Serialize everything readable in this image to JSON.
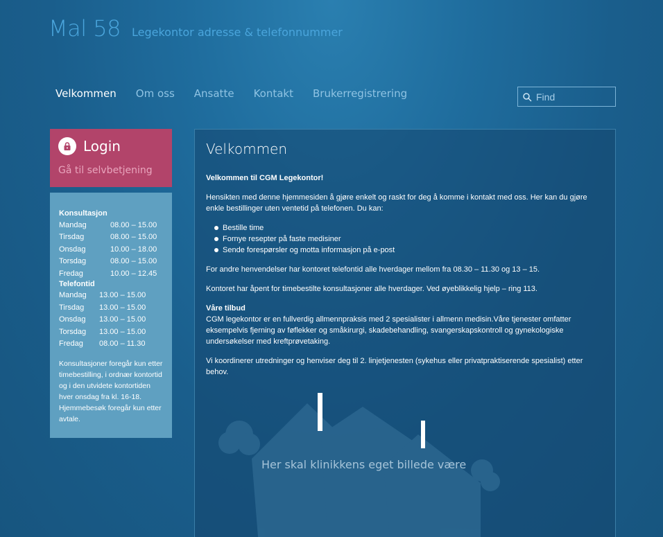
{
  "header": {
    "brand": "Mal 58",
    "tagline": "Legekontor adresse & telefonnummer"
  },
  "nav": [
    "Velkommen",
    "Om oss",
    "Ansatte",
    "Kontakt",
    "Brukerregistrering"
  ],
  "search": {
    "placeholder": "Find"
  },
  "login": {
    "title": "Login",
    "link": "Gå til selvbetjening"
  },
  "hours": {
    "consult_title": "Konsultasjon",
    "consult": [
      {
        "day": "Mandag",
        "time": "08.00 – 15.00"
      },
      {
        "day": "Tirsdag",
        "time": "08.00 – 15.00"
      },
      {
        "day": "Onsdag",
        "time": "10.00 – 18.00"
      },
      {
        "day": "Torsdag",
        "time": "08.00 – 15.00"
      },
      {
        "day": "Fredag",
        "time": "10.00 – 12.45"
      }
    ],
    "phone_title": "Telefontid",
    "phone": [
      {
        "day": "Mandag",
        "time": "13.00 – 15.00"
      },
      {
        "day": "Tirsdag",
        "time": "13.00 – 15.00"
      },
      {
        "day": "Onsdag",
        "time": "13.00 – 15.00"
      },
      {
        "day": "Torsdag",
        "time": "13.00 – 15.00"
      },
      {
        "day": "Fredag",
        "time": "08.00 – 11.30"
      }
    ],
    "note": "Konsultasjoner foregår kun etter timebestilling, i ordnær kontortid og i den utvidete kontortiden hver onsdag fra kl. 16-18. Hjemmebesøk foregår kun etter avtale."
  },
  "main": {
    "title": "Velkommen",
    "intro_bold": "Velkommen til CGM Legekontor!",
    "p1": "Hensikten med denne hjemmesiden å gjøre enkelt og raskt for deg å komme i kontakt med oss. Her kan du gjøre enkle bestillinger uten ventetid på telefonen. Du kan:",
    "bullets": [
      "Bestille time",
      "Fornye resepter på faste medisiner",
      "Sende forespørsler og motta informasjon på e-post"
    ],
    "p2": "For andre henvendelser har kontoret telefontid alle hverdager mellom fra 08.30 – 11.30 og 13 – 15.",
    "p3": "Kontoret har åpent for timebestilte konsultasjoner alle hverdager. Ved øyeblikkelig hjelp – ring 113.",
    "offer_title": "Våre tilbud",
    "p4": "CGM legekontor er en fullverdig allmennpraksis med 2 spesialister i allmenn medisin.Våre tjenester omfatter eksempelvis fjerning av føflekker og småkirurgi, skadebehandling, svangerskapskontroll og gynekologiske undersøkelser med kreftprøvetaking.",
    "p5": "Vi koordinerer utredninger og henviser deg til 2. linjetjenesten (sykehus eller privatpraktiserende spesialist) etter behov.",
    "image_caption": "Her skal klinikkens eget billede være"
  },
  "colors": {
    "brand": "#4aa5dc",
    "login_bg": "#b2446a",
    "hours_bg": "#5fa0c1"
  }
}
